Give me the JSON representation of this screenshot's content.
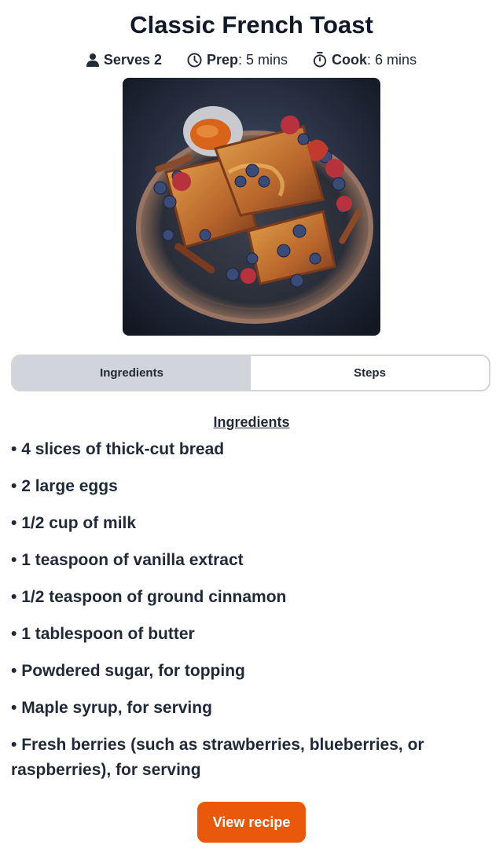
{
  "recipe": {
    "title": "Classic French Toast",
    "serves_label": "Serves 2",
    "prep_label": "Prep",
    "prep_value": ": 5 mins",
    "cook_label": "Cook",
    "cook_value": ": 6 mins"
  },
  "tabs": [
    {
      "label": "Ingredients",
      "active": true
    },
    {
      "label": "Steps",
      "active": false
    }
  ],
  "section": {
    "title": "Ingredients"
  },
  "ingredients": [
    "4 slices of thick-cut bread",
    "2 large eggs",
    "1/2 cup of milk",
    "1 teaspoon of vanilla extract",
    "1/2 teaspoon of ground cinnamon",
    "1 tablespoon of butter",
    "Powdered sugar, for topping",
    "Maple syrup, for serving",
    "Fresh berries (such as strawberries, blueberries, or raspberries), for serving"
  ],
  "cta": {
    "label": "View recipe"
  },
  "colors": {
    "accent": "#ea580c",
    "active_tab": "#d1d5db",
    "text": "#1f2937"
  },
  "icons": [
    "person-icon",
    "clock-icon",
    "stopwatch-icon"
  ]
}
